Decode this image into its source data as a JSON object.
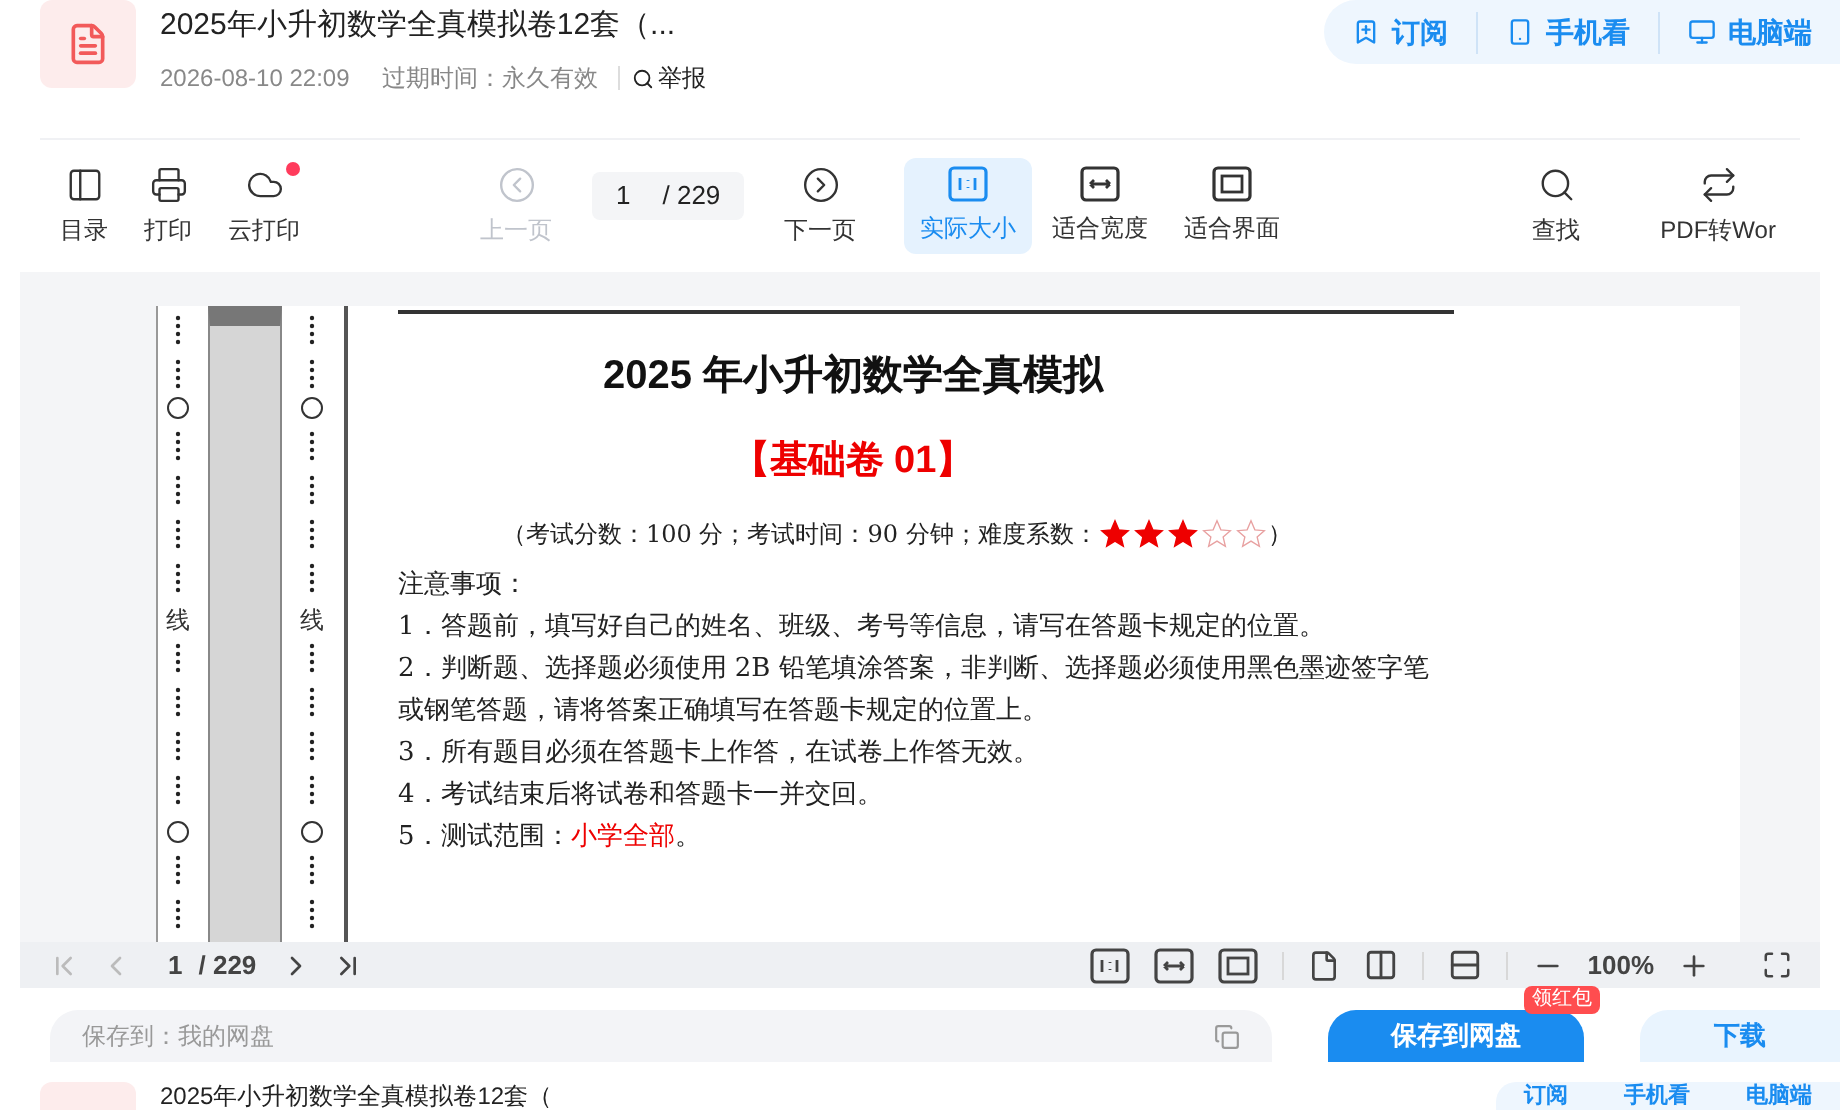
{
  "header": {
    "title": "2025年小升初数学全真模拟卷12套（...",
    "date": "2026-08-10 22:09",
    "expiry_label": "过期时间：",
    "expiry_value": "永久有效",
    "report": "举报",
    "actions": [
      "订阅",
      "手机看",
      "电脑端"
    ]
  },
  "toolbar": {
    "items": [
      {
        "kind": "tool",
        "label": "目录",
        "selected": false,
        "disabled": false,
        "notification": false
      },
      {
        "kind": "tool",
        "label": "打印",
        "selected": false,
        "disabled": false,
        "notification": false
      },
      {
        "kind": "tool",
        "label": "云打印",
        "selected": false,
        "disabled": false,
        "notification": true
      },
      {
        "kind": "tool",
        "label": "上一页",
        "selected": false,
        "disabled": true,
        "notification": false
      },
      {
        "kind": "pager",
        "page": "1",
        "total": "/ 229"
      },
      {
        "kind": "tool",
        "label": "下一页",
        "selected": false,
        "disabled": false,
        "notification": false
      },
      {
        "kind": "tool",
        "label": "实际大小",
        "selected": true,
        "disabled": false,
        "notification": false
      },
      {
        "kind": "tool",
        "label": "适合宽度",
        "selected": false,
        "disabled": false,
        "notification": false
      },
      {
        "kind": "tool",
        "label": "适合界面",
        "selected": false,
        "disabled": false,
        "notification": false
      },
      {
        "kind": "tool",
        "label": "查找",
        "selected": false,
        "disabled": false,
        "notification": false
      },
      {
        "kind": "tool",
        "label": "PDF转Wor",
        "selected": false,
        "disabled": false,
        "notification": false
      }
    ]
  },
  "document": {
    "binding_text": [
      "线",
      "线"
    ],
    "title": "2025 年小升初数学全真模拟",
    "subtitle": "【基础卷 01】",
    "info": "（考试分数：100 分；考试时间：90 分钟；难度系数：",
    "stars": 3,
    "info_end": "）",
    "notes_heading": "注意事项：",
    "notes": [
      "1．答题前，填写好自己的姓名、班级、考号等信息，请写在答题卡规定的位置。",
      "2．判断题、选择题必须使用 2B 铅笔填涂答案，非判断、选择题必须使用黑色墨迹签字笔或钢笔答题，请将答案正确填写在答题卡规定的位置上。",
      "3．所有题目必须在答题卡上作答，在试卷上作答无效。",
      "4．考试结束后将试卷和答题卡一并交回。",
      {
        "text": "5．测试范围：",
        "highlight": "小学全部",
        "text_end": "。"
      }
    ]
  },
  "viewer_bar": {
    "page": "1",
    "total": "/ 229",
    "zoom": "100%"
  },
  "save_bar": {
    "path": "保存到：我的网盘",
    "save_button": "保存到网盘",
    "badge": "领红包",
    "download": "下载"
  },
  "sticky_header": {
    "title": "2025年小升初数学全真模拟卷12套（",
    "actions": [
      "订阅",
      "手机看",
      "电脑端"
    ]
  }
}
